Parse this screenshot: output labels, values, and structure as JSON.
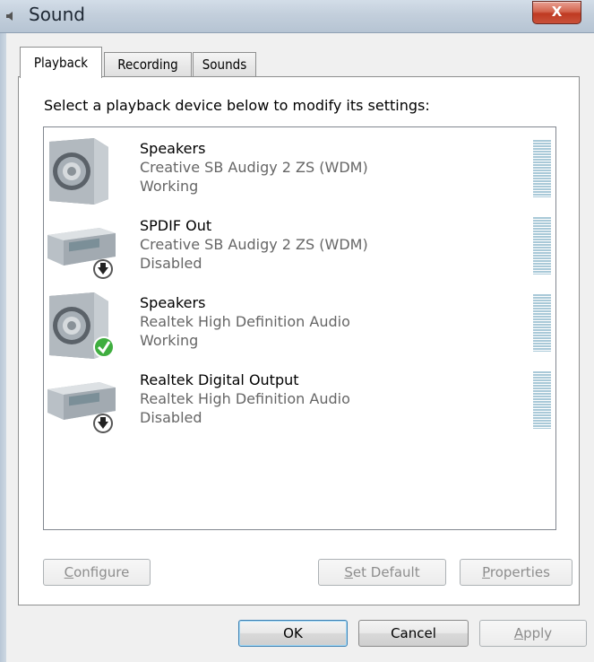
{
  "window": {
    "title": "Sound",
    "close_label": "X"
  },
  "tabs": [
    {
      "label": "Playback",
      "active": true
    },
    {
      "label": "Recording",
      "active": false
    },
    {
      "label": "Sounds",
      "active": false
    }
  ],
  "instruction": "Select a playback device below to modify its settings:",
  "devices": [
    {
      "name": "Speakers",
      "description": "Creative SB Audigy 2 ZS (WDM)",
      "status": "Working",
      "icon": "speaker-icon",
      "badge": "none"
    },
    {
      "name": "SPDIF Out",
      "description": "Creative SB Audigy 2 ZS (WDM)",
      "status": "Disabled",
      "icon": "digital-output-icon",
      "badge": "disabled-arrow"
    },
    {
      "name": "Speakers",
      "description": "Realtek High Definition Audio",
      "status": "Working",
      "icon": "speaker-icon",
      "badge": "default-check"
    },
    {
      "name": "Realtek Digital Output",
      "description": "Realtek High Definition Audio",
      "status": "Disabled",
      "icon": "digital-output-icon",
      "badge": "disabled-arrow"
    }
  ],
  "buttons": {
    "configure": {
      "underline": "C",
      "rest": "onfigure",
      "enabled": false
    },
    "set_default": {
      "underline": "S",
      "rest": "et Default",
      "enabled": false
    },
    "properties": {
      "underline": "P",
      "rest": "roperties",
      "enabled": false
    },
    "ok": {
      "label": "OK"
    },
    "cancel": {
      "label": "Cancel"
    },
    "apply": {
      "underline": "A",
      "rest": "pply",
      "enabled": false
    }
  },
  "colors": {
    "meter": "#a9c9d8",
    "check_badge": "#3fae3f",
    "close_button": "#c9513a"
  }
}
